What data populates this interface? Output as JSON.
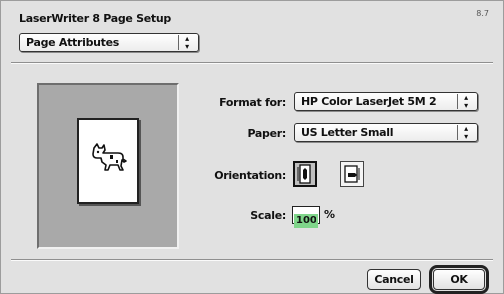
{
  "dialog": {
    "title": "LaserWriter 8 Page Setup",
    "version": "8.7"
  },
  "panel_menu": {
    "selected": "Page Attributes"
  },
  "format_for": {
    "label": "Format for:",
    "selected": "HP Color LaserJet 5M 2"
  },
  "paper": {
    "label": "Paper:",
    "selected": "US Letter Small"
  },
  "orientation": {
    "label": "Orientation:",
    "options": [
      "portrait",
      "landscape"
    ],
    "selected": "portrait"
  },
  "scale": {
    "label": "Scale:",
    "value": "100",
    "unit": "%"
  },
  "buttons": {
    "cancel": "Cancel",
    "ok": "OK"
  },
  "icons": {
    "preview": "dogcow-icon",
    "portrait": "portrait-orientation-icon",
    "landscape": "landscape-orientation-icon",
    "popup": "popup-arrows-icon"
  }
}
